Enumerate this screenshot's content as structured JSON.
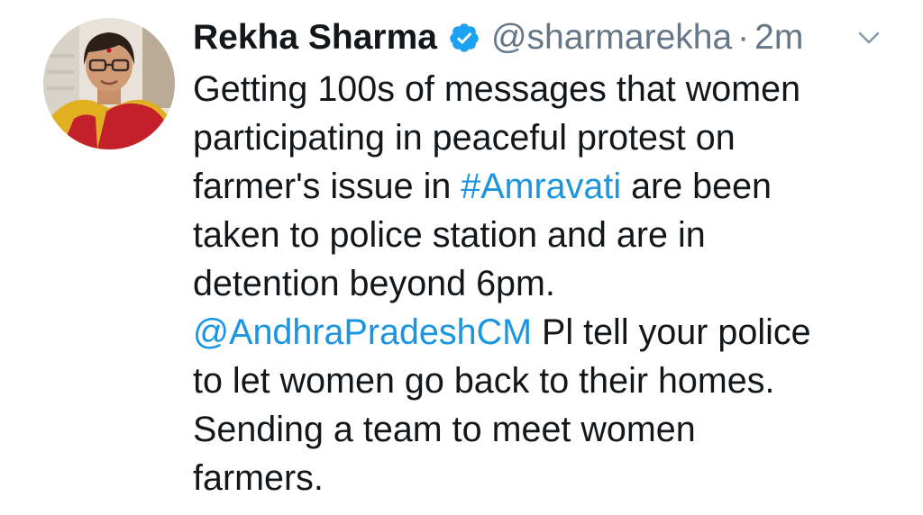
{
  "tweet": {
    "author": {
      "display_name": "Rekha Sharma",
      "handle": "@sharmarekha",
      "verified": true,
      "verified_icon": "verified-badge-icon",
      "avatar_icon": "profile-photo"
    },
    "separator": "·",
    "timestamp": "2m",
    "menu_icon": "chevron-down-icon",
    "lines": [
      [
        {
          "text": "Getting 100s of messages that women"
        }
      ],
      [
        {
          "text": "participating in peaceful protest on"
        }
      ],
      [
        {
          "text": "farmer's issue in "
        },
        {
          "text": "#Amravati",
          "link": true
        },
        {
          "text": " are been"
        }
      ],
      [
        {
          "text": "taken to police station and are in"
        }
      ],
      [
        {
          "text": "detention beyond 6pm."
        }
      ],
      [
        {
          "text": "@AndhraPradeshCM",
          "link": true
        },
        {
          "text": " Pl tell your police"
        }
      ],
      [
        {
          "text": "to let women go back to their homes."
        }
      ],
      [
        {
          "text": "Sending a team to meet women"
        }
      ],
      [
        {
          "text": "farmers."
        }
      ]
    ],
    "colors": {
      "text": "#14171a",
      "muted": "#657786",
      "link": "#1b95e0",
      "verified": "#1da1f2"
    }
  }
}
